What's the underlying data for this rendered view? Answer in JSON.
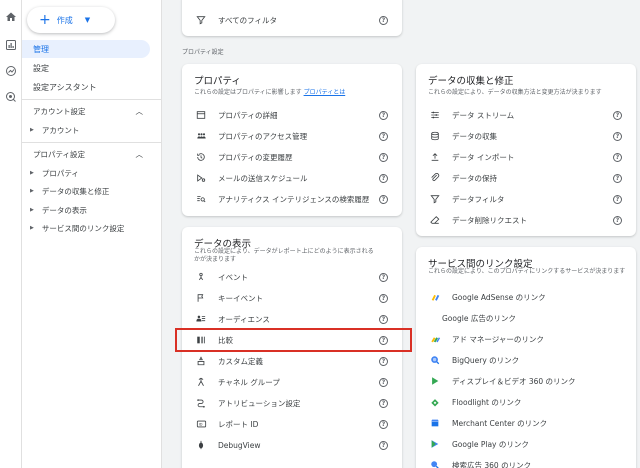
{
  "sidebar": {
    "create_label": "作成",
    "items": [
      {
        "label": "管理"
      },
      {
        "label": "設定"
      },
      {
        "label": "設定アシスタント"
      }
    ],
    "account_header": "アカウント設定",
    "account_items": [
      {
        "label": "アカウント"
      }
    ],
    "property_header": "プロパティ設定",
    "property_items": [
      {
        "label": "プロパティ"
      },
      {
        "label": "データの収集と修正"
      },
      {
        "label": "データの表示"
      },
      {
        "label": "サービス間のリンク設定"
      }
    ]
  },
  "top_card": {
    "filter_label": "すべてのフィルタ"
  },
  "section_label": "プロパティ設定",
  "property_card": {
    "title": "プロパティ",
    "desc": "これらの設定はプロパティに影響します",
    "link": "プロパティとは",
    "rows": [
      {
        "label": "プロパティの詳細",
        "icon": "details-icon"
      },
      {
        "label": "プロパティのアクセス管理",
        "icon": "people-icon"
      },
      {
        "label": "プロパティの変更履歴",
        "icon": "history-icon"
      },
      {
        "label": "メールの送信スケジュール",
        "icon": "schedule-email-icon"
      },
      {
        "label": "アナリティクス インテリジェンスの検索履歴",
        "icon": "search-history-icon"
      }
    ]
  },
  "data_collection_card": {
    "title": "データの収集と修正",
    "desc": "これらの設定により、データの収集方法と変更方法が決まります",
    "rows": [
      {
        "label": "データ ストリーム",
        "icon": "streams-icon"
      },
      {
        "label": "データの収集",
        "icon": "database-icon"
      },
      {
        "label": "データ インポート",
        "icon": "upload-icon"
      },
      {
        "label": "データの保持",
        "icon": "retention-icon"
      },
      {
        "label": "データフィルタ",
        "icon": "filter-icon"
      },
      {
        "label": "データ削除リクエスト",
        "icon": "eraser-icon"
      }
    ]
  },
  "data_display_card": {
    "title": "データの表示",
    "desc1": "これらの設定により、データがレポート上にどのように表示される",
    "desc2": "かが決まります",
    "rows": [
      {
        "label": "イベント",
        "icon": "event-icon"
      },
      {
        "label": "キーイベント",
        "icon": "flag-icon"
      },
      {
        "label": "オーディエンス",
        "icon": "audience-icon"
      },
      {
        "label": "比較",
        "icon": "compare-icon"
      },
      {
        "label": "カスタム定義",
        "icon": "custom-definition-icon"
      },
      {
        "label": "チャネル グループ",
        "icon": "channel-group-icon"
      },
      {
        "label": "アトリビューション設定",
        "icon": "attribution-icon"
      },
      {
        "label": "レポート ID",
        "icon": "report-id-icon"
      },
      {
        "label": "DebugView",
        "icon": "debug-icon"
      }
    ]
  },
  "links_card": {
    "title": "サービス間のリンク設定",
    "desc": "これらの設定により、このプロパティにリンクするサービスが決まります",
    "rows": [
      {
        "label": "Google AdSense のリンク",
        "icon": "adsense-icon"
      },
      {
        "label": "Google 広告のリンク",
        "icon": "google-ads-icon"
      },
      {
        "label": "アド マネージャーのリンク",
        "icon": "ad-manager-icon"
      },
      {
        "label": "BigQuery のリンク",
        "icon": "bigquery-icon"
      },
      {
        "label": "ディスプレイ＆ビデオ 360 のリンク",
        "icon": "dv360-icon"
      },
      {
        "label": "Floodlight のリンク",
        "icon": "floodlight-icon"
      },
      {
        "label": "Merchant Center のリンク",
        "icon": "merchant-center-icon"
      },
      {
        "label": "Google Play のリンク",
        "icon": "google-play-icon"
      },
      {
        "label": "検索広告 360 のリンク",
        "icon": "sa360-icon"
      }
    ]
  },
  "help_glyph": "?",
  "colors": {
    "accent": "#1a73e8",
    "highlight": "#d93025",
    "active_bg": "#e8f0fe"
  }
}
